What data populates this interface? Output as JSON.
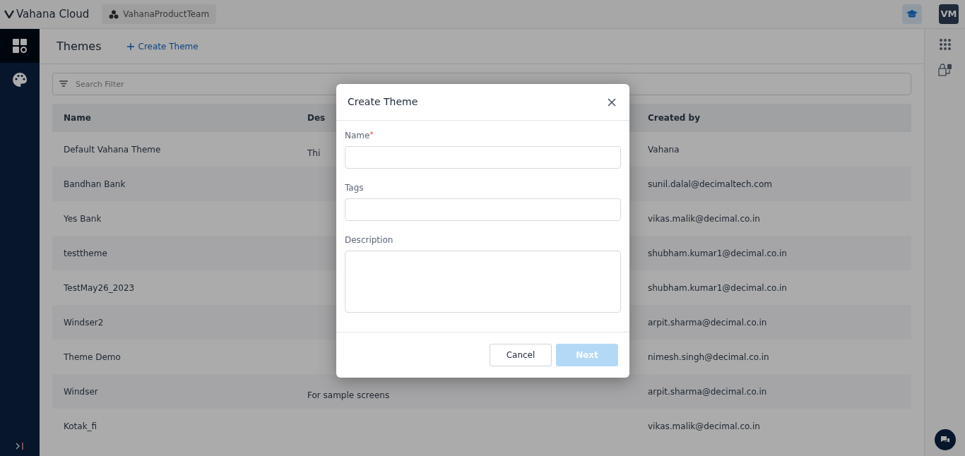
{
  "topbar": {
    "brand": "Vahana Cloud",
    "workspace": "VahanaProductTeam",
    "avatar": "VM"
  },
  "sidebar": {
    "items": [
      {
        "kind": "dashboard",
        "selected": true
      },
      {
        "kind": "palette",
        "selected": false
      }
    ]
  },
  "header": {
    "title": "Themes",
    "action": "Create Theme"
  },
  "search": {
    "placeholder": "Search Filter"
  },
  "table": {
    "columns": [
      "Name",
      "Des",
      "Created by"
    ],
    "rows": [
      [
        "Default Vahana Theme",
        "Thi",
        "Vahana"
      ],
      [
        "Bandhan Bank",
        "",
        "sunil.dalal@decimaltech.com"
      ],
      [
        "Yes Bank",
        "",
        "vikas.malik@decimal.co.in"
      ],
      [
        "testtheme",
        "",
        "shubham.kumar1@decimal.co.in"
      ],
      [
        "TestMay26_2023",
        "",
        "shubham.kumar1@decimal.co.in"
      ],
      [
        "Windser2",
        "",
        "arpit.sharma@decimal.co.in"
      ],
      [
        "Theme Demo",
        "",
        "nimesh.singh@decimal.co.in"
      ],
      [
        "Windser",
        "For sample screens",
        "arpit.sharma@decimal.co.in"
      ],
      [
        "Kotak_fi",
        "",
        "vikas.malik@decimal.co.in"
      ]
    ]
  },
  "modal": {
    "title": "Create Theme",
    "fields": [
      {
        "label": "Name",
        "required_mark": "*",
        "kind": "input"
      },
      {
        "label": "Tags",
        "kind": "input"
      },
      {
        "label": "Description",
        "kind": "textarea"
      }
    ],
    "buttons": [
      {
        "label": "Cancel",
        "kind": "secondary",
        "disabled": false
      },
      {
        "label": "Next",
        "kind": "primary",
        "disabled": true
      }
    ]
  }
}
